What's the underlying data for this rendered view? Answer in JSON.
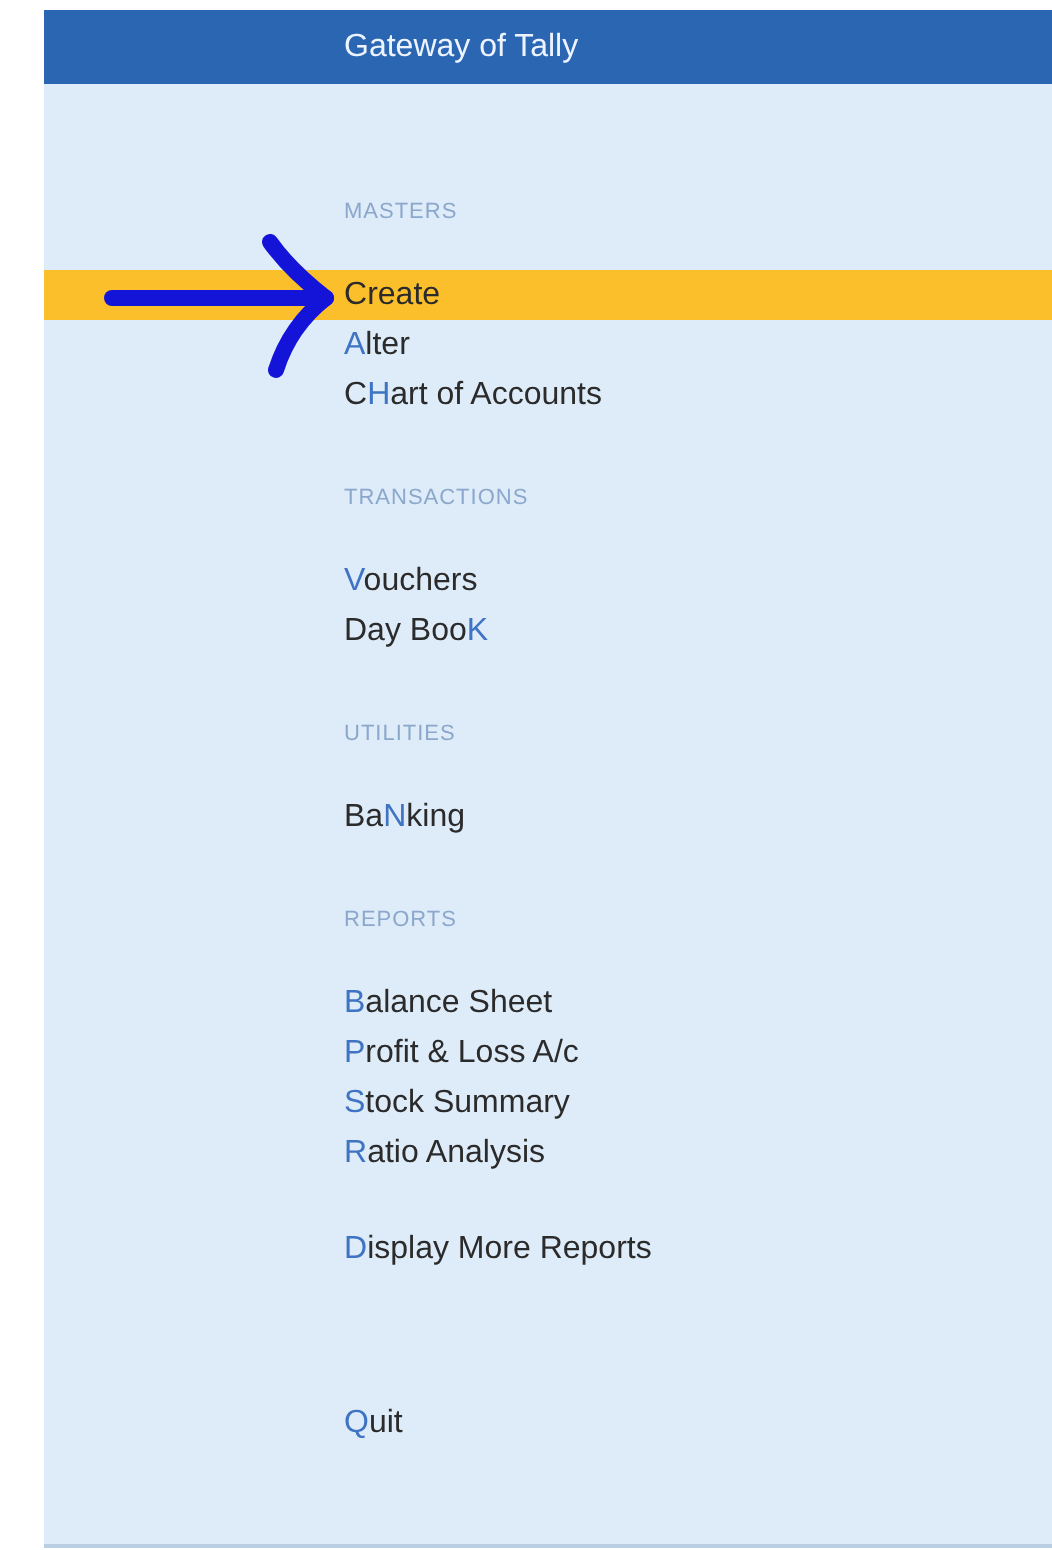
{
  "window": {
    "title": "Gateway of Tally"
  },
  "sections": [
    {
      "heading": "MASTERS",
      "groups": [
        [
          {
            "key": "C",
            "after": "reate",
            "selected": true
          },
          {
            "key": "A",
            "after": "lter",
            "selected": false
          },
          {
            "before": "C",
            "key": "H",
            "after": "art of Accounts",
            "selected": false
          }
        ]
      ]
    },
    {
      "heading": "TRANSACTIONS",
      "groups": [
        [
          {
            "key": "V",
            "after": "ouchers",
            "selected": false
          },
          {
            "before": "Day Boo",
            "key": "K",
            "selected": false
          }
        ]
      ]
    },
    {
      "heading": "UTILITIES",
      "groups": [
        [
          {
            "before": "Ba",
            "key": "N",
            "after": "king",
            "selected": false
          }
        ]
      ]
    },
    {
      "heading": "REPORTS",
      "groups": [
        [
          {
            "key": "B",
            "after": "alance Sheet",
            "selected": false
          },
          {
            "key": "P",
            "after": "rofit & Loss A/c",
            "selected": false
          },
          {
            "key": "S",
            "after": "tock Summary",
            "selected": false
          },
          {
            "key": "R",
            "after": "atio Analysis",
            "selected": false
          }
        ],
        [
          {
            "key": "D",
            "after": "isplay More Reports",
            "selected": false
          }
        ]
      ]
    },
    {
      "groups": [
        [
          {
            "key": "Q",
            "after": "uit",
            "selected": false
          }
        ]
      ]
    }
  ]
}
